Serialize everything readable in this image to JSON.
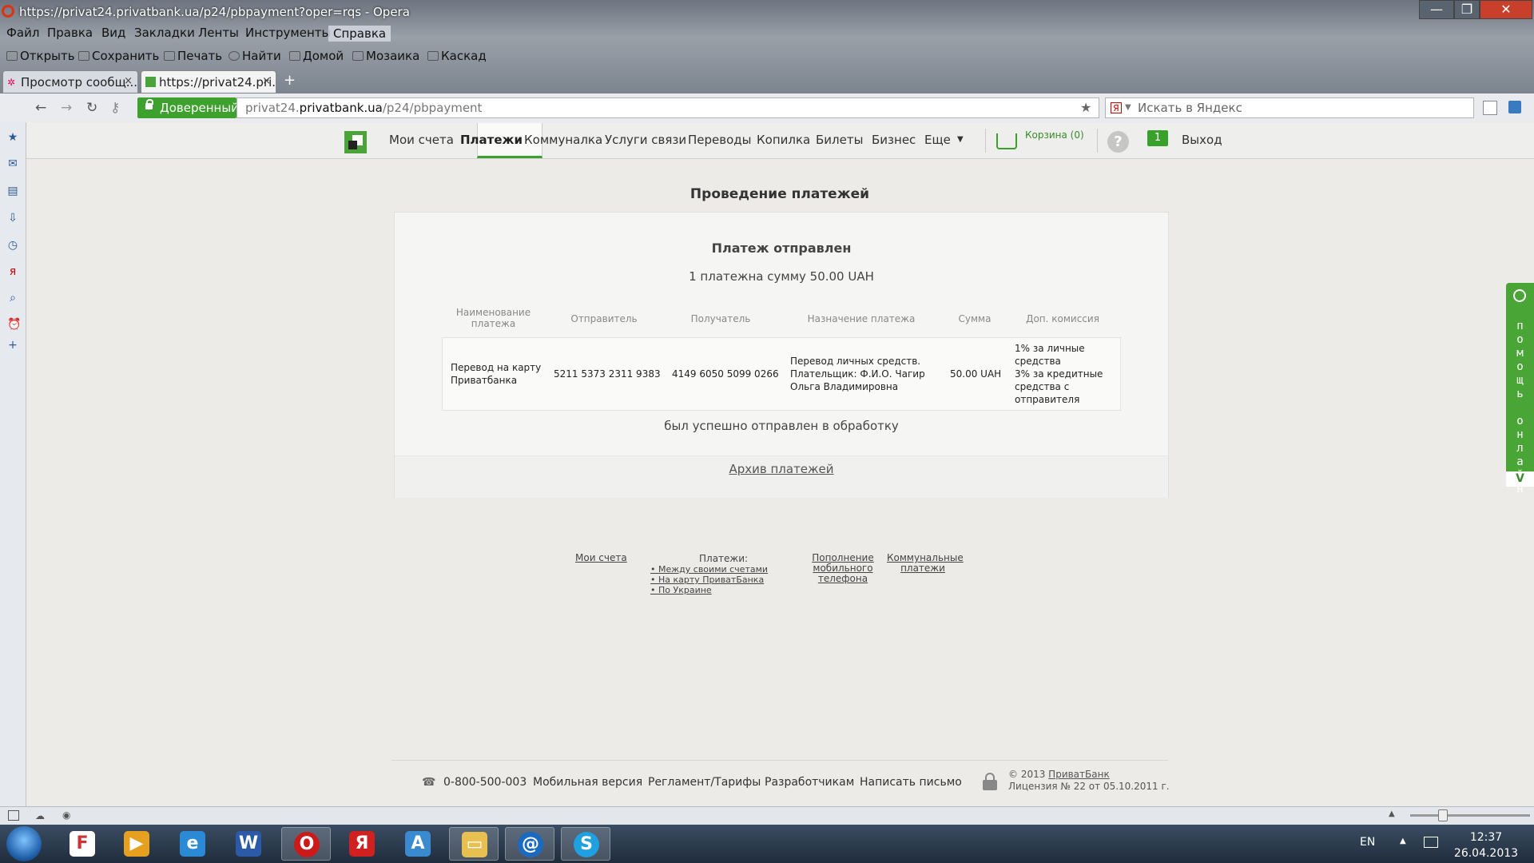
{
  "window": {
    "title": "https://privat24.privatbank.ua/p24/pbpayment?oper=rqs - Opera",
    "btn_min": "—",
    "btn_max": "❐",
    "btn_close": "✕"
  },
  "menubar": [
    "Файл",
    "Правка",
    "Вид",
    "Закладки",
    "Ленты",
    "Инструменты",
    "Справка"
  ],
  "toolbar": [
    "Открыть",
    "Сохранить",
    "Печать",
    "Найти",
    "Домой",
    "Мозаика",
    "Каскад"
  ],
  "tabs": [
    {
      "label": "Просмотр сообщ...",
      "close": "×"
    },
    {
      "label": "https://privat24.pri...",
      "close": "×"
    }
  ],
  "new_tab": "+",
  "address": {
    "badge": "Доверенный",
    "url_prefix": "privat24.",
    "url_host": "privatbank.ua",
    "url_path": "/p24/pbpayment",
    "search_placeholder": "Искать в Яндекс",
    "search_engine_glyph": "Я"
  },
  "sitenav": {
    "items": [
      "Мои счета",
      "Платежи",
      "Коммуналка",
      "Услуги связи",
      "Переводы",
      "Копилка",
      "Билеты",
      "Бизнес",
      "Еще"
    ],
    "more_caret": "▼",
    "cart": "Корзина (0)",
    "help": "?",
    "messages_count": "1",
    "logout": "Выход"
  },
  "page_title": "Проведение платежей",
  "payment": {
    "status_title": "Платеж отправлен",
    "summary": "1 платежна сумму 50.00 UAH",
    "columns": [
      "Наименование платежа",
      "Отправитель",
      "Получатель",
      "Назначение платежа",
      "Сумма",
      "Доп. комиссия"
    ],
    "row": {
      "name": "Перевод на карту Приватбанка",
      "sender": "5211 5373 2311 9383",
      "recipient": "4149 6050 5099 0266",
      "purpose": "Перевод личных средств. Плательщик: Ф.И.О. Чагир Ольга Владимировна",
      "amount": "50.00 UAH",
      "commission": "1% за личные средства\n3% за кредитные средства с отправителя"
    },
    "done": "был успешно отправлен в обработку",
    "archive": "Архив платежей"
  },
  "footer_links": {
    "accounts": "Мои счета",
    "payments_title": "Платежи:",
    "payments_sub": [
      "Между своими счетами",
      "На карту ПриватБанка",
      "По Украине"
    ],
    "mobile": "Пополнение мобильного телефона",
    "communal": "Коммунальные платежи"
  },
  "footer_bar": {
    "phone": "0-800-500-003",
    "links": [
      "Мобильная версия",
      "Регламент/Тарифы",
      "Разработчикам",
      "Написать письмо"
    ],
    "copyright_prefix": "© 2013 ",
    "copyright_link": "ПриватБанк",
    "license": "Лицензия № 22 от 05.10.2011 г."
  },
  "help_widget": {
    "text": "помощь онлайн",
    "toggle": "V"
  },
  "taskbar": {
    "lang": "EN",
    "time": "12:37",
    "date": "26.04.2013"
  },
  "colors": {
    "accent_green": "#3aa02c",
    "trusted_green": "#3ea12d"
  }
}
